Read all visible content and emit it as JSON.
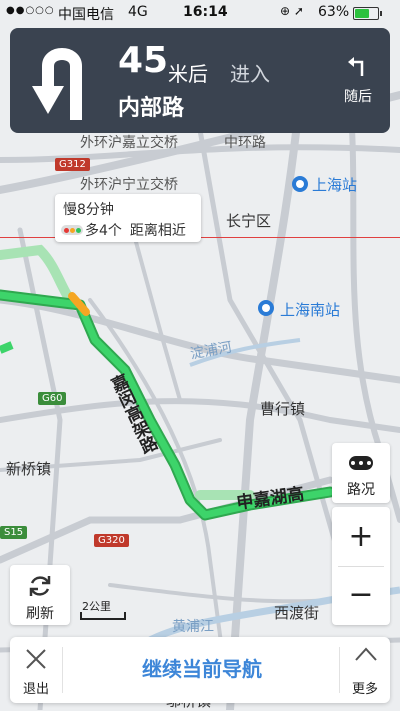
{
  "status_bar": {
    "signal": "●●○○○",
    "carrier": "中国电信",
    "network": "4G",
    "time": "16:14",
    "icons": "⊕ ➚",
    "battery_text": "63%",
    "battery_level": 0.63
  },
  "guidance": {
    "distance_number": "45",
    "distance_unit": "米后",
    "action": "进入",
    "road_name": "内部路",
    "follow_label": "随后",
    "turn_icon": "u-turn-left-icon",
    "follow_icon": "turn-left-icon"
  },
  "traffic_info": {
    "delay": "慢8分钟",
    "detail": "多4个",
    "distance_note": "距离相近"
  },
  "map_labels": {
    "outer_ring_jiading": "外环沪嘉立交桥",
    "middle_ring": "中环路",
    "outer_ring_ning": "外环沪宁立交桥",
    "shanghai_station": "上海站",
    "changning": "长宁区",
    "shanghai_south": "上海南站",
    "puhe": "淀浦河",
    "jiamin_elevated": "嘉闵高架路",
    "caohang": "曹行镇",
    "xinqiao": "新桥镇",
    "shenjia": "申嘉湖高",
    "huangpu": "黄浦江",
    "xidu": "西渡街",
    "zhuqiao": "邬桥镇",
    "g312": "G312",
    "g60": "G60",
    "g320": "G320",
    "s15": "S15"
  },
  "controls": {
    "traffic": "路况",
    "zoom_in": "+",
    "zoom_out": "−",
    "refresh": "刷新",
    "scale": "2公里"
  },
  "bottom_bar": {
    "exit": "退出",
    "continue": "继续当前导航",
    "more": "更多"
  },
  "colors": {
    "banner": "#3a4350",
    "route_green": "#2fc25b",
    "route_yellow": "#f5a623",
    "accent_blue": "#3d86d8"
  }
}
